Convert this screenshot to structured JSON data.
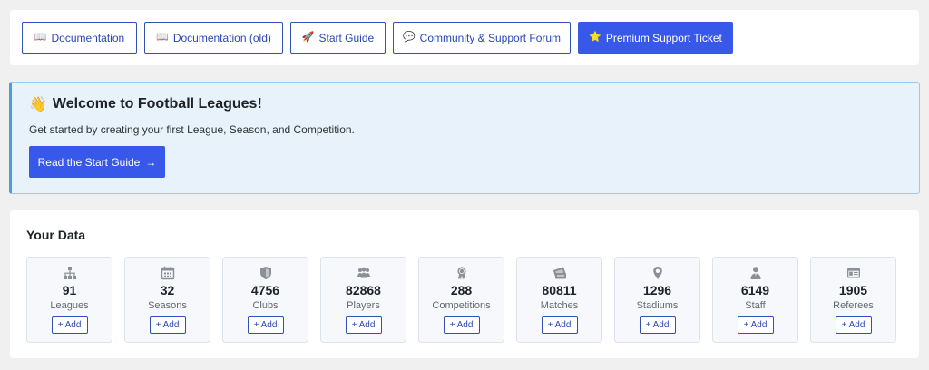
{
  "toolbar": {
    "buttons": [
      {
        "icon": "📖",
        "label": "Documentation"
      },
      {
        "icon": "📖",
        "label": "Documentation (old)"
      },
      {
        "icon": "🚀",
        "label": "Start Guide"
      },
      {
        "icon": "💬",
        "label": "Community & Support Forum"
      },
      {
        "icon": "⭐",
        "label": "Premium Support Ticket"
      }
    ]
  },
  "welcome": {
    "icon": "👋",
    "title": "Welcome to Football Leagues!",
    "description": "Get started by creating your first League, Season, and Competition.",
    "cta_label": "Read the Start Guide",
    "cta_arrow": "→"
  },
  "data_section": {
    "heading": "Your Data",
    "add_label": "+ Add",
    "stats": [
      {
        "icon": "sitemap-icon",
        "value": "91",
        "label": "Leagues"
      },
      {
        "icon": "calendar-icon",
        "value": "32",
        "label": "Seasons"
      },
      {
        "icon": "shield-icon",
        "value": "4756",
        "label": "Clubs"
      },
      {
        "icon": "users-icon",
        "value": "82868",
        "label": "Players"
      },
      {
        "icon": "award-icon",
        "value": "288",
        "label": "Competitions"
      },
      {
        "icon": "tickets-icon",
        "value": "80811",
        "label": "Matches"
      },
      {
        "icon": "location-icon",
        "value": "1296",
        "label": "Stadiums"
      },
      {
        "icon": "staff-icon",
        "value": "6149",
        "label": "Staff"
      },
      {
        "icon": "id-card-icon",
        "value": "1905",
        "label": "Referees"
      }
    ]
  },
  "colors": {
    "accent": "#3858e9",
    "notice_background": "#e7f2fb",
    "notice_border": "#4a9edc",
    "icon_gray": "#8c8f94"
  }
}
